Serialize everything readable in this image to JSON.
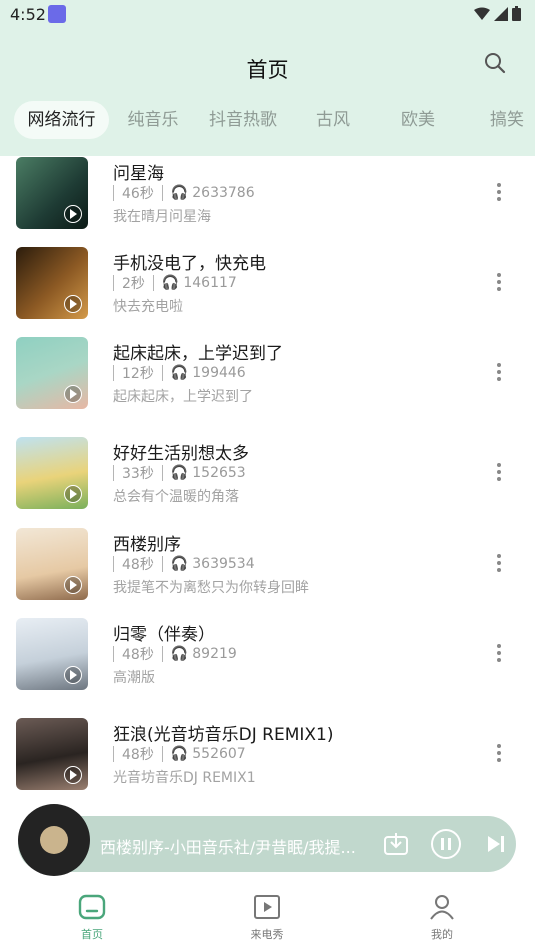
{
  "status": {
    "time": "4:52"
  },
  "header": {
    "title": "首页"
  },
  "tabs": [
    "网络流行",
    "纯音乐",
    "抖音热歌",
    "古风",
    "欧美",
    "搞笑"
  ],
  "songs": [
    {
      "title": "问星海",
      "duration": "46秒",
      "plays": "2633786",
      "sub": "我在晴月问星海"
    },
    {
      "title": "手机没电了，快充电",
      "duration": "2秒",
      "plays": "146117",
      "sub": "快去充电啦"
    },
    {
      "title": "起床起床，上学迟到了",
      "duration": "12秒",
      "plays": "199446",
      "sub": "起床起床，上学迟到了"
    },
    {
      "title": "好好生活别想太多",
      "duration": "33秒",
      "plays": "152653",
      "sub": "总会有个温暖的角落"
    },
    {
      "title": "西楼别序",
      "duration": "48秒",
      "plays": "3639534",
      "sub": "我提笔不为离愁只为你转身回眸"
    },
    {
      "title": "归零（伴奏）",
      "duration": "48秒",
      "plays": "89219",
      "sub": "高潮版"
    },
    {
      "title": "狂浪(光音坊音乐DJ REMIX1)",
      "duration": "48秒",
      "plays": "552607",
      "sub": "光音坊音乐DJ REMIX1"
    }
  ],
  "player": {
    "now_playing": "西楼别序-小田音乐社/尹昔眠/我提..."
  },
  "nav": {
    "home": "首页",
    "show": "来电秀",
    "mine": "我的"
  },
  "colors": {
    "accent": "#4aa67b",
    "header_bg": "#dff2e8"
  }
}
